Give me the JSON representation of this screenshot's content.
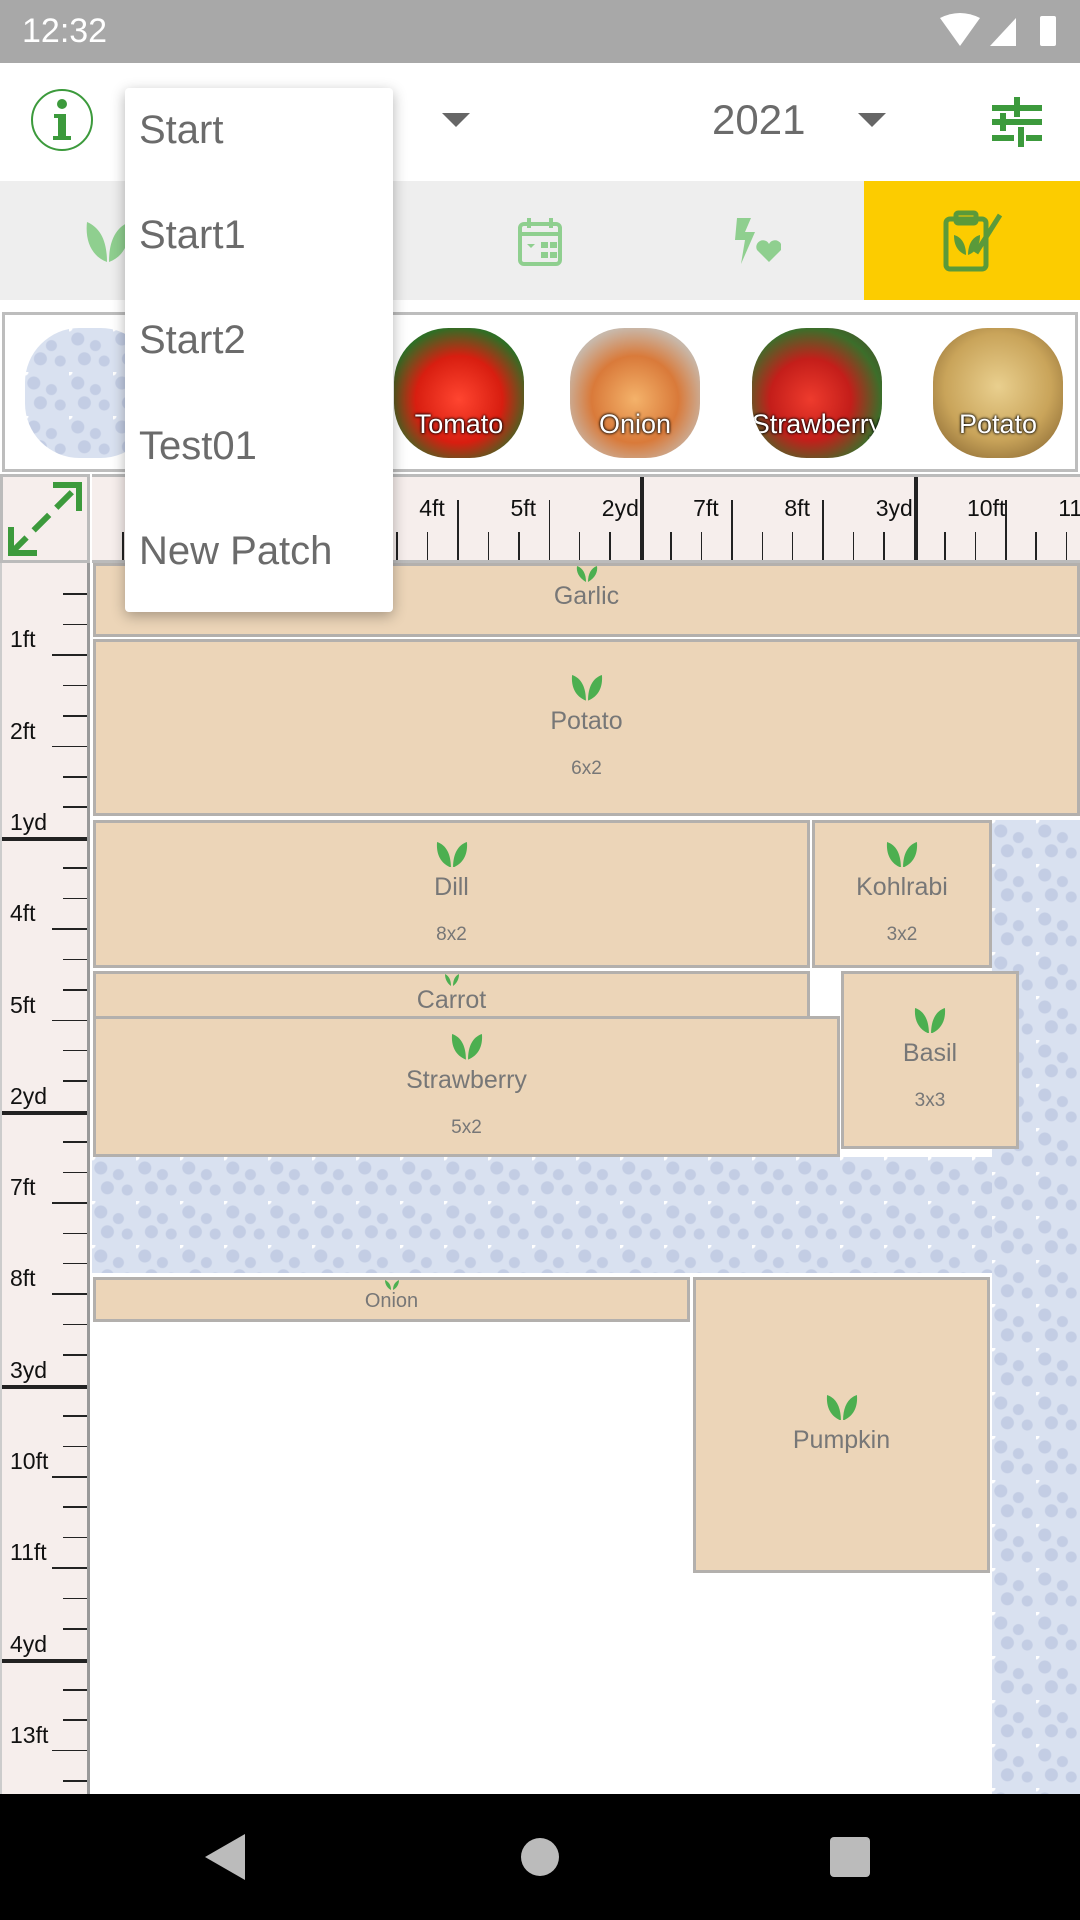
{
  "status": {
    "time": "12:32",
    "icons": [
      "wifi-icon",
      "signal-icon",
      "battery-icon"
    ]
  },
  "header": {
    "year": "2021",
    "icons": [
      "info-icon",
      "dropdown-arrow-icon",
      "settings-sliders-icon"
    ]
  },
  "dropdown": {
    "items": [
      "Start",
      "Start1",
      "Start2",
      "Test01",
      "New Patch"
    ]
  },
  "tabs": [
    {
      "icon": "leaf-icon"
    },
    {
      "icon": "hidden"
    },
    {
      "icon": "calendar-icon"
    },
    {
      "icon": "lightning-heart-icon"
    },
    {
      "icon": "clipboard-check-icon",
      "active": true
    }
  ],
  "plant_strip": [
    {
      "label": "",
      "kind": "path-tile"
    },
    {
      "label": "Tomato"
    },
    {
      "label": "Onion"
    },
    {
      "label": "Strawberry"
    },
    {
      "label": "Potato"
    }
  ],
  "ruler": {
    "top_labels": [
      "4ft",
      "5ft",
      "2yd",
      "7ft",
      "8ft",
      "3yd",
      "10ft",
      "11"
    ],
    "left_labels": [
      "1ft",
      "2ft",
      "1yd",
      "4ft",
      "5ft",
      "2yd",
      "7ft",
      "8ft",
      "3yd",
      "10ft",
      "11ft",
      "4yd",
      "13ft"
    ]
  },
  "patches": [
    {
      "name": "Garlic",
      "size": ""
    },
    {
      "name": "Potato",
      "size": "6x2"
    },
    {
      "name": "Dill",
      "size": "8x2"
    },
    {
      "name": "Kohlrabi",
      "size": "3x2"
    },
    {
      "name": "Carrot",
      "size": ""
    },
    {
      "name": "Strawberry",
      "size": "5x2"
    },
    {
      "name": "Basil",
      "size": "3x3"
    },
    {
      "name": "Onion",
      "size": ""
    },
    {
      "name": "Pumpkin",
      "size": ""
    }
  ],
  "colors": {
    "accent_green": "#3c9a3c",
    "active_tab": "#fccc00",
    "patch": "#ecd5b8",
    "path": "#d9e1f0"
  }
}
